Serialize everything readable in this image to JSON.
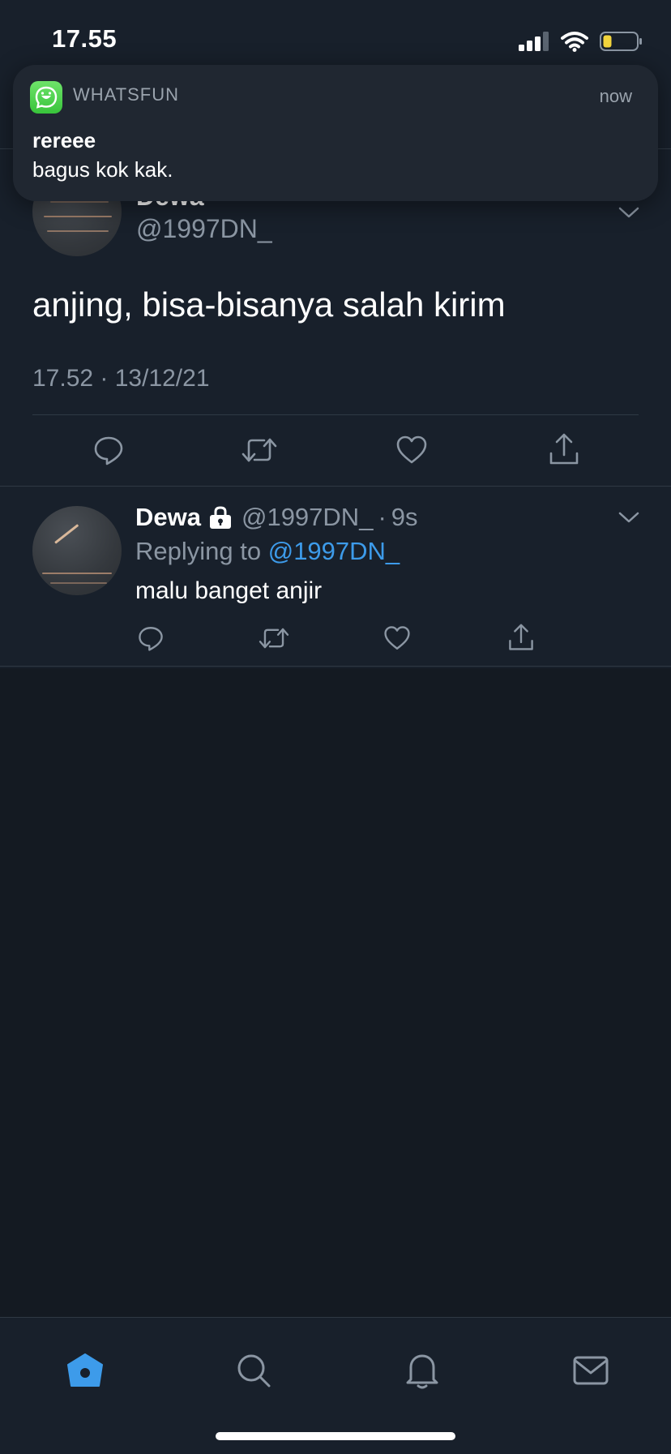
{
  "status_bar": {
    "time": "17.55"
  },
  "notification": {
    "app_name": "WHATSFUN",
    "time": "now",
    "title": "rereee",
    "body": "bagus kok kak."
  },
  "main_tweet": {
    "name": "Dewa",
    "handle": "@1997DN_",
    "text": "anjing, bisa-bisanya salah kirim",
    "timestamp": "17.52 · 13/12/21"
  },
  "reply": {
    "name": "Dewa",
    "handle": "@1997DN_",
    "dot": "·",
    "time": "9s",
    "replying_prefix": "Replying to",
    "replying_handle": "@1997DN_",
    "text": "malu banget anjir"
  },
  "colors": {
    "accent": "#3d9bea",
    "background": "#141a22",
    "card": "#18202b",
    "muted": "#8b96a3"
  },
  "icons": {
    "actions": [
      "reply-icon",
      "retweet-icon",
      "like-icon",
      "share-icon"
    ],
    "tabs": [
      "home-icon",
      "search-icon",
      "notifications-icon",
      "messages-icon"
    ]
  }
}
